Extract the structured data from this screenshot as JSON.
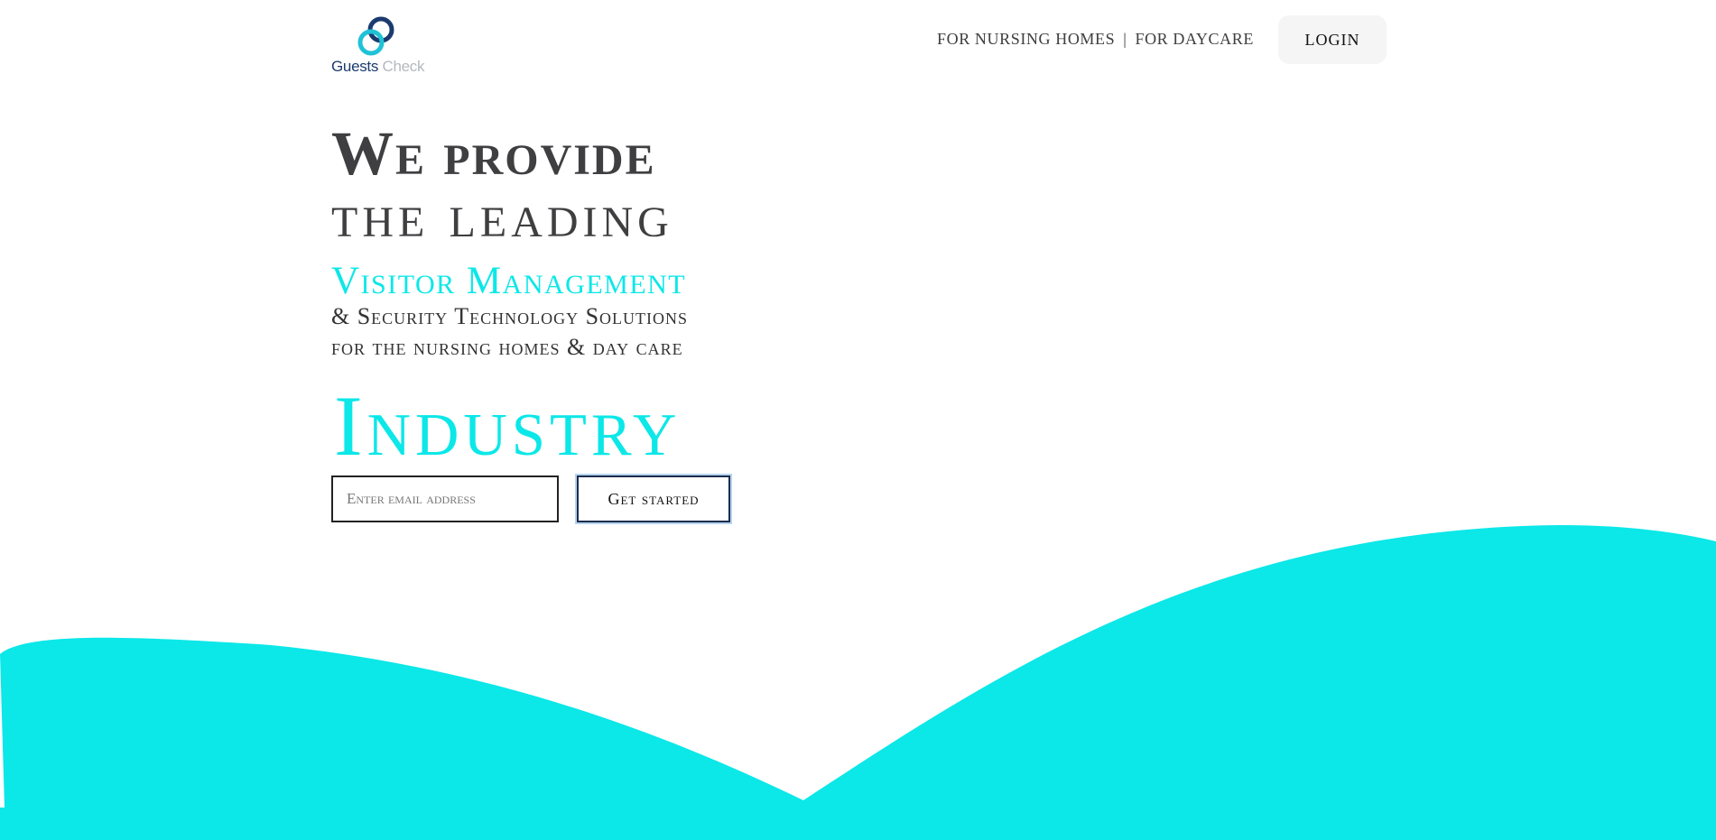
{
  "brand": {
    "name_part1": "Guests",
    "name_part2": "Check"
  },
  "nav": {
    "items": [
      "FOR NURSING HOMES",
      "FOR DAYCARE"
    ],
    "separator": "|",
    "login_label": "LOGIN"
  },
  "hero": {
    "line1": "We provide",
    "line2": "the leading",
    "highlight": "Visitor Management",
    "sub1": "& Security Technology Solutions",
    "sub2": "for the nursing homes & day care",
    "industry": "Industry"
  },
  "signup": {
    "email_placeholder": "Enter email address",
    "cta_label": "Get started"
  },
  "colors": {
    "accent": "#0ce7e8",
    "heading": "#3f3f41",
    "logo_dark": "#1b3b6f",
    "logo_light": "#b4b8bf"
  }
}
